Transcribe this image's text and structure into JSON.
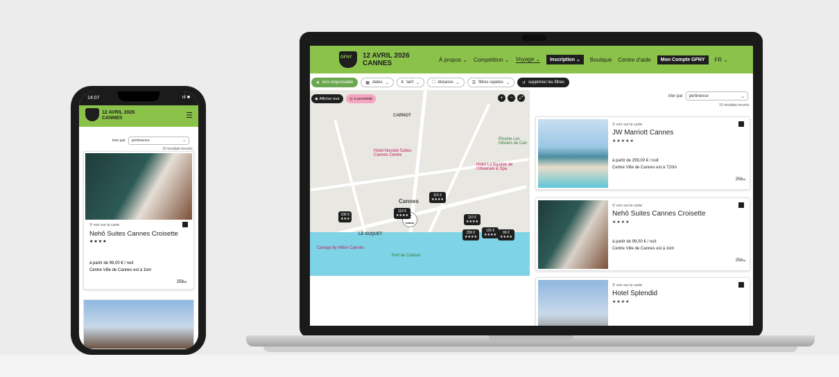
{
  "laptop": {
    "nav": {
      "date": "12 AVRIL 2026",
      "city": "CANNES",
      "logo_text": "GFNY",
      "items": [
        "À propos ⌄",
        "Compétition ⌄",
        "Voyage ⌄",
        "Inscription ⌄",
        "Boutique",
        "Centre d'aide",
        "Mon Compte GFNY",
        "FR ⌄"
      ]
    },
    "filters": [
      "éco-responsable",
      "dates",
      "tarif",
      "distance",
      "filtres rapides",
      "supprimer les filtres"
    ],
    "map": {
      "show_all": "Afficher tout",
      "nearby": "à proximité",
      "cluster_count": "2",
      "cluster_label": "hotels",
      "labels": [
        "CARNOT",
        "Cannes",
        "LE SUQUET",
        "Hotel Novotel Suites Cannes Centre",
        "Piscine Les Oliviers de Can",
        "Hotel La Bastide de l'Oliveraie & Spa",
        "Canopy by Hilton Cannes",
        "Port de Cannes"
      ],
      "pins": [
        "106 €",
        "110 €",
        "115 €",
        "110 €",
        "259 €",
        "125 €",
        "99 €"
      ]
    },
    "sort": {
      "label": "trier par",
      "value": "pertinence",
      "results": "10 résultats trouvés"
    },
    "hotels": [
      {
        "link": "voir sur la carte",
        "name": "JW Marriott Cannes",
        "stars": "★★★★★",
        "price": "à partir de  259,00 € / nuit",
        "distance": "Centre Ville de Cannes est à 720m",
        "beds": "25🛏"
      },
      {
        "link": "voir sur la carte",
        "name": "Nehō Suites Cannes Croisette",
        "stars": "★★★★",
        "price": "à partir de  99,00 € / nuit",
        "distance": "Centre Ville de Cannes est à 1km",
        "beds": "25🛏"
      },
      {
        "link": "voir sur la carte",
        "name": "Hotel Splendid",
        "stars": "★★★★",
        "price": "",
        "distance": "",
        "beds": ""
      }
    ]
  },
  "phone": {
    "time": "14:07",
    "status_icons": "ııl ■",
    "date": "12 AVRIL 2026",
    "city": "CANNES",
    "sort": {
      "label": "trier par",
      "value": "pertinence",
      "results": "10 résultats trouvés"
    },
    "hotel": {
      "link": "voir sur la carte",
      "name": "Nehō Suites Cannes Croisette",
      "stars": "★★★★",
      "price": "à partir de  99,00 € / nuit",
      "distance": "Centre Ville de Cannes est à 1km",
      "beds": "25🛏"
    }
  },
  "colors": {
    "brand_green": "#8bc34a",
    "dark": "#1e1e1e",
    "sea": "#7fd3e6"
  }
}
